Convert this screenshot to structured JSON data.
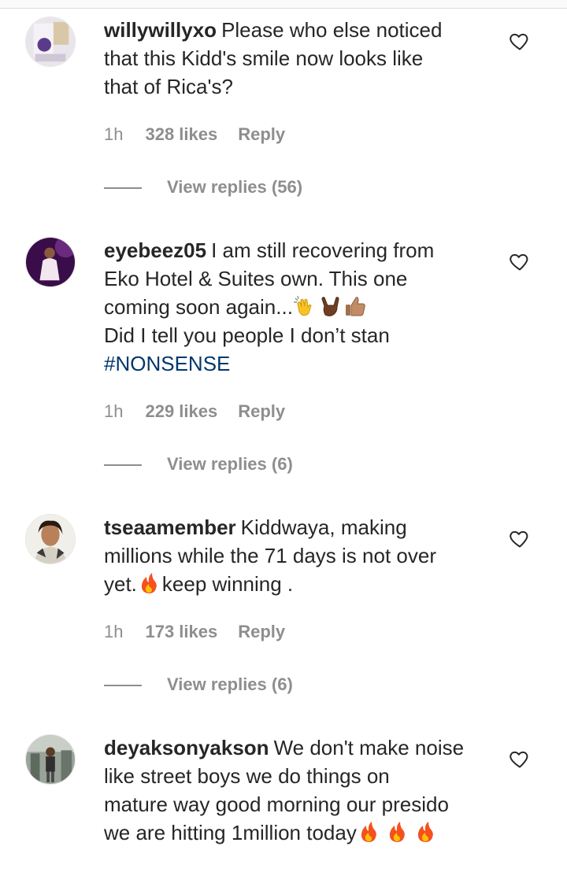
{
  "comments": [
    {
      "username": "willywillyxo",
      "lines": [
        "Please who else noticed",
        "that this Kidd's smile now looks like",
        "that of Rica's?"
      ],
      "time": "1h",
      "likes": "328 likes",
      "reply": "Reply",
      "view_replies": "View replies (56)"
    },
    {
      "username": "eyebeez05",
      "lines": [
        "I am still recovering from",
        "Eko Hotel & Suites own. This one",
        "coming soon again...",
        "Did I tell you people I don’t stan",
        "#NONSENSE"
      ],
      "emojis_line3": [
        "clapping-hands-emoji",
        "love-you-gesture-emoji",
        "thumbs-up-emoji"
      ],
      "time": "1h",
      "likes": "229 likes",
      "reply": "Reply",
      "view_replies": "View replies (6)"
    },
    {
      "username": "tseaamember",
      "lines": [
        "Kiddwaya, making",
        "millions while the 71 days is not over",
        "yet.",
        "keep winning ."
      ],
      "time": "1h",
      "likes": "173 likes",
      "reply": "Reply",
      "view_replies": "View replies (6)"
    },
    {
      "username": "deyaksonyakson",
      "lines": [
        "We don't make noise",
        "like street boys we do things on",
        "mature way good morning our presido",
        "we are hitting 1million today"
      ],
      "emojis_line4": [
        "fire-emoji",
        "fire-emoji",
        "fire-emoji"
      ]
    }
  ],
  "colors": {
    "text": "#262626",
    "muted": "#8e8e8e",
    "hashtag": "#00376b"
  },
  "icons": {
    "like": "heart-outline-icon"
  }
}
